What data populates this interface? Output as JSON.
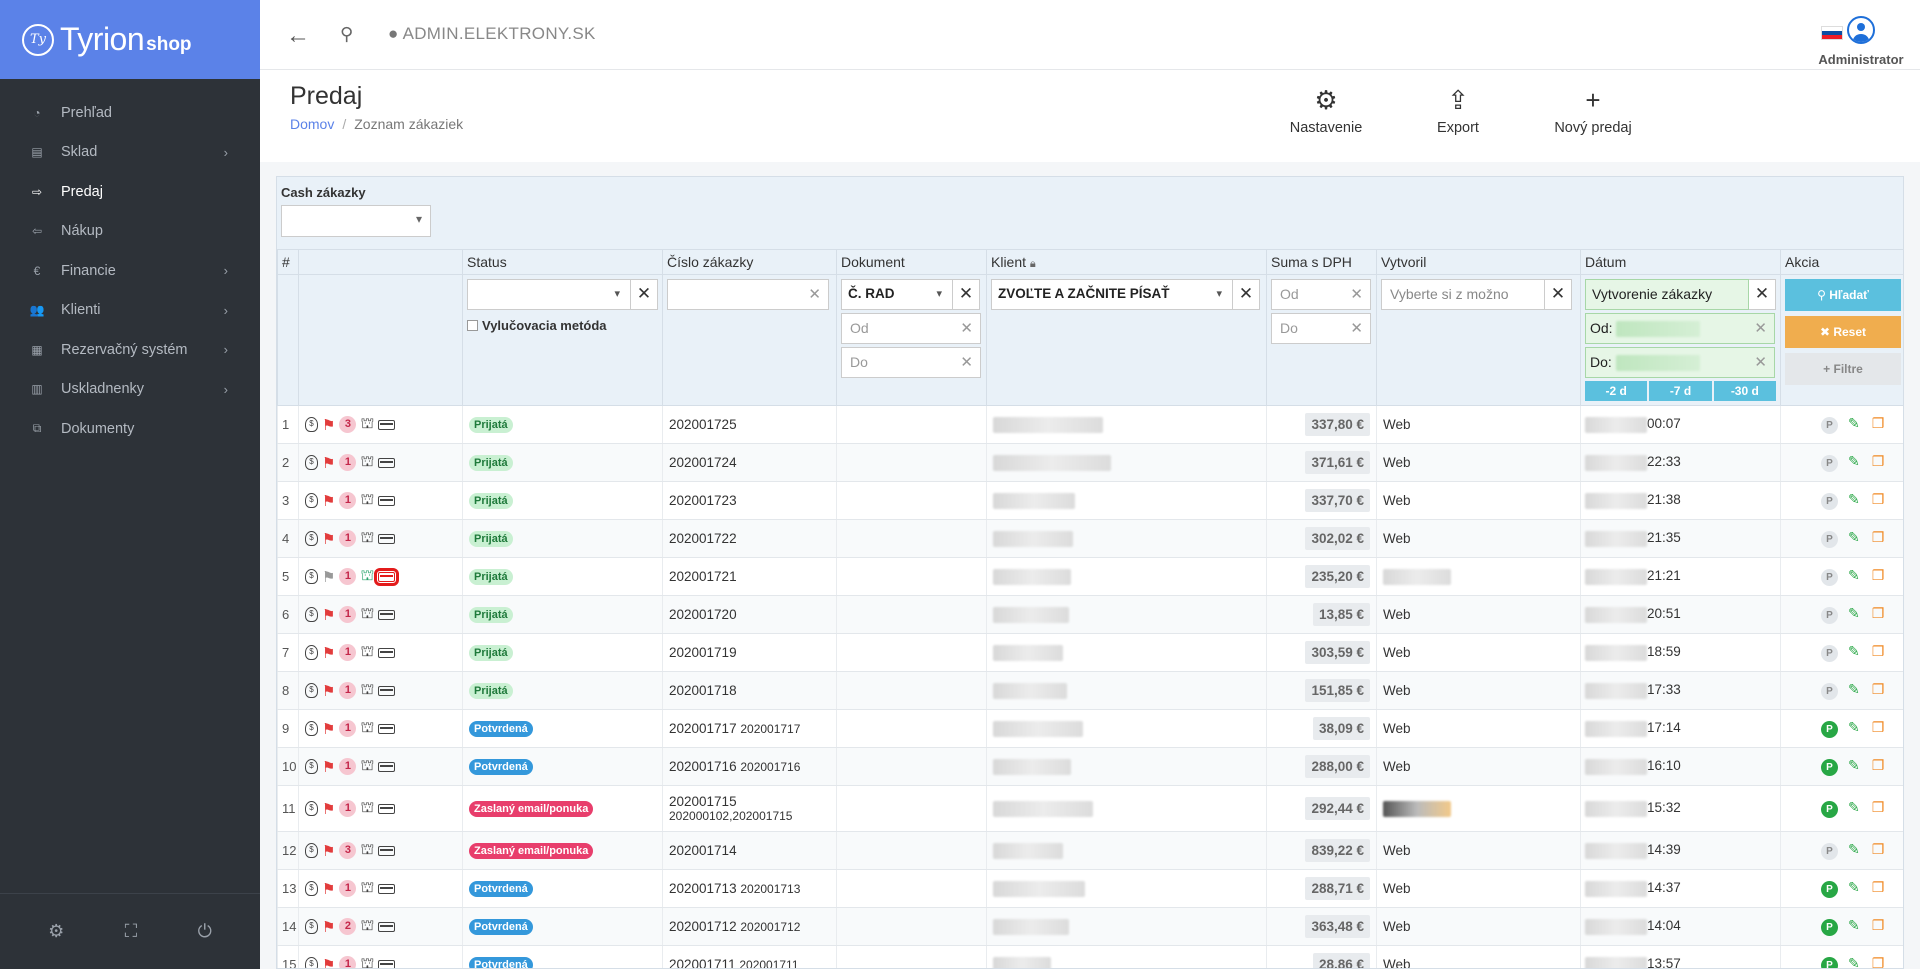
{
  "app": {
    "logo_main": "Tyrion",
    "logo_sub": "shop",
    "logo_mark": "Ty"
  },
  "sidebar": {
    "items": [
      {
        "label": "Prehľad",
        "icon": "dashboard-icon",
        "glyph": "◔",
        "chevron": false,
        "active": false
      },
      {
        "label": "Sklad",
        "icon": "archive-icon",
        "glyph": "▤",
        "chevron": true,
        "active": false
      },
      {
        "label": "Predaj",
        "icon": "sign-out-icon",
        "glyph": "⇨",
        "chevron": false,
        "active": true
      },
      {
        "label": "Nákup",
        "icon": "sign-in-icon",
        "glyph": "⇦",
        "chevron": false,
        "active": false
      },
      {
        "label": "Financie",
        "icon": "euro-icon",
        "glyph": "€",
        "chevron": true,
        "active": false
      },
      {
        "label": "Klienti",
        "icon": "users-icon",
        "glyph": "👥",
        "chevron": true,
        "active": false
      },
      {
        "label": "Rezervačný systém",
        "icon": "calendar-icon",
        "glyph": "▦",
        "chevron": true,
        "active": false
      },
      {
        "label": "Uskladnenky",
        "icon": "storage-icon",
        "glyph": "▥",
        "chevron": true,
        "active": false
      },
      {
        "label": "Dokumenty",
        "icon": "documents-icon",
        "glyph": "⧉",
        "chevron": false,
        "active": false
      }
    ]
  },
  "topbar": {
    "url": "ADMIN.ELEKTRONY.SK",
    "user": "Administrator",
    "language": "SK"
  },
  "page": {
    "title": "Predaj",
    "breadcrumb_home": "Domov",
    "breadcrumb_current": "Zoznam zákaziek",
    "actions": {
      "settings": "Nastavenie",
      "export": "Export",
      "new": "Nový predaj"
    }
  },
  "filters": {
    "cash_label": "Cash zákazky",
    "exclusion_method": "Vylučovacia metóda",
    "document_selected": "Č. RAD",
    "doc_from": "Od",
    "doc_to": "Do",
    "client_placeholder": "ZVOĽTE A ZAČNITE PÍSAŤ",
    "sum_from": "Od",
    "sum_to": "Do",
    "creator_placeholder": "Vyberte si z možno",
    "date_type": "Vytvorenie zákazky",
    "date_from_label": "Od:",
    "date_to_label": "Do:",
    "quick": [
      "-2 d",
      "-7 d",
      "-30 d"
    ],
    "btn_search": "Hľadať",
    "btn_reset": "Reset",
    "btn_filters": "Filtre"
  },
  "columns": [
    "#",
    "",
    "Status",
    "Číslo zákazky",
    "Dokument",
    "Klient",
    "Suma s DPH",
    "Vytvoril",
    "Dátum",
    "Akcia"
  ],
  "colors": {
    "sidebar": "#2d3238",
    "logo": "#5b82e8",
    "search": "#5bc0de",
    "reset": "#f0ad4e",
    "prijata": "#c9f0d2",
    "potvrdena": "#3498db",
    "zaslany": "#e83e6c"
  },
  "rows": [
    {
      "n": "1",
      "count": "3",
      "status": "Prijatá",
      "order": "202001725",
      "sub": "",
      "sum": "337,80 €",
      "creator": "Web",
      "time": "00:07",
      "p": "grey"
    },
    {
      "n": "2",
      "count": "1",
      "status": "Prijatá",
      "order": "202001724",
      "sub": "",
      "sum": "371,61 €",
      "creator": "Web",
      "time": "22:33",
      "p": "grey"
    },
    {
      "n": "3",
      "count": "1",
      "status": "Prijatá",
      "order": "202001723",
      "sub": "",
      "sum": "337,70 €",
      "creator": "Web",
      "time": "21:38",
      "p": "grey"
    },
    {
      "n": "4",
      "count": "1",
      "status": "Prijatá",
      "order": "202001722",
      "sub": "",
      "sum": "302,02 €",
      "creator": "Web",
      "time": "21:35",
      "p": "grey"
    },
    {
      "n": "5",
      "count": "1",
      "status": "Prijatá",
      "order": "202001721",
      "sub": "",
      "sum": "235,20 €",
      "creator": "",
      "time": "21:21",
      "p": "grey"
    },
    {
      "n": "6",
      "count": "1",
      "status": "Prijatá",
      "order": "202001720",
      "sub": "",
      "sum": "13,85 €",
      "creator": "Web",
      "time": "20:51",
      "p": "grey"
    },
    {
      "n": "7",
      "count": "1",
      "status": "Prijatá",
      "order": "202001719",
      "sub": "",
      "sum": "303,59 €",
      "creator": "Web",
      "time": "18:59",
      "p": "grey"
    },
    {
      "n": "8",
      "count": "1",
      "status": "Prijatá",
      "order": "202001718",
      "sub": "",
      "sum": "151,85 €",
      "creator": "Web",
      "time": "17:33",
      "p": "grey"
    },
    {
      "n": "9",
      "count": "1",
      "status": "Potvrdená",
      "order": "202001717",
      "sub": "202001717",
      "sum": "38,09 €",
      "creator": "Web",
      "time": "17:14",
      "p": "green"
    },
    {
      "n": "10",
      "count": "1",
      "status": "Potvrdená",
      "order": "202001716",
      "sub": "202001716",
      "sum": "288,00 €",
      "creator": "Web",
      "time": "16:10",
      "p": "green"
    },
    {
      "n": "11",
      "count": "1",
      "status": "Zaslaný email/ponuka",
      "order": "202001715",
      "sub": "202000102,202001715",
      "sum": "292,44 €",
      "creator": "",
      "time": "15:32",
      "p": "green"
    },
    {
      "n": "12",
      "count": "3",
      "status": "Zaslaný email/ponuka",
      "order": "202001714",
      "sub": "",
      "sum": "839,22 €",
      "creator": "Web",
      "time": "14:39",
      "p": "grey"
    },
    {
      "n": "13",
      "count": "1",
      "status": "Potvrdená",
      "order": "202001713",
      "sub": "202001713",
      "sum": "288,71 €",
      "creator": "Web",
      "time": "14:37",
      "p": "green"
    },
    {
      "n": "14",
      "count": "2",
      "status": "Potvrdená",
      "order": "202001712",
      "sub": "202001712",
      "sum": "363,48 €",
      "creator": "Web",
      "time": "14:04",
      "p": "green"
    },
    {
      "n": "15",
      "count": "1",
      "status": "Potvrdená",
      "order": "202001711",
      "sub": "202001711",
      "sum": "28,86 €",
      "creator": "Web",
      "time": "13:57",
      "p": "green"
    }
  ]
}
